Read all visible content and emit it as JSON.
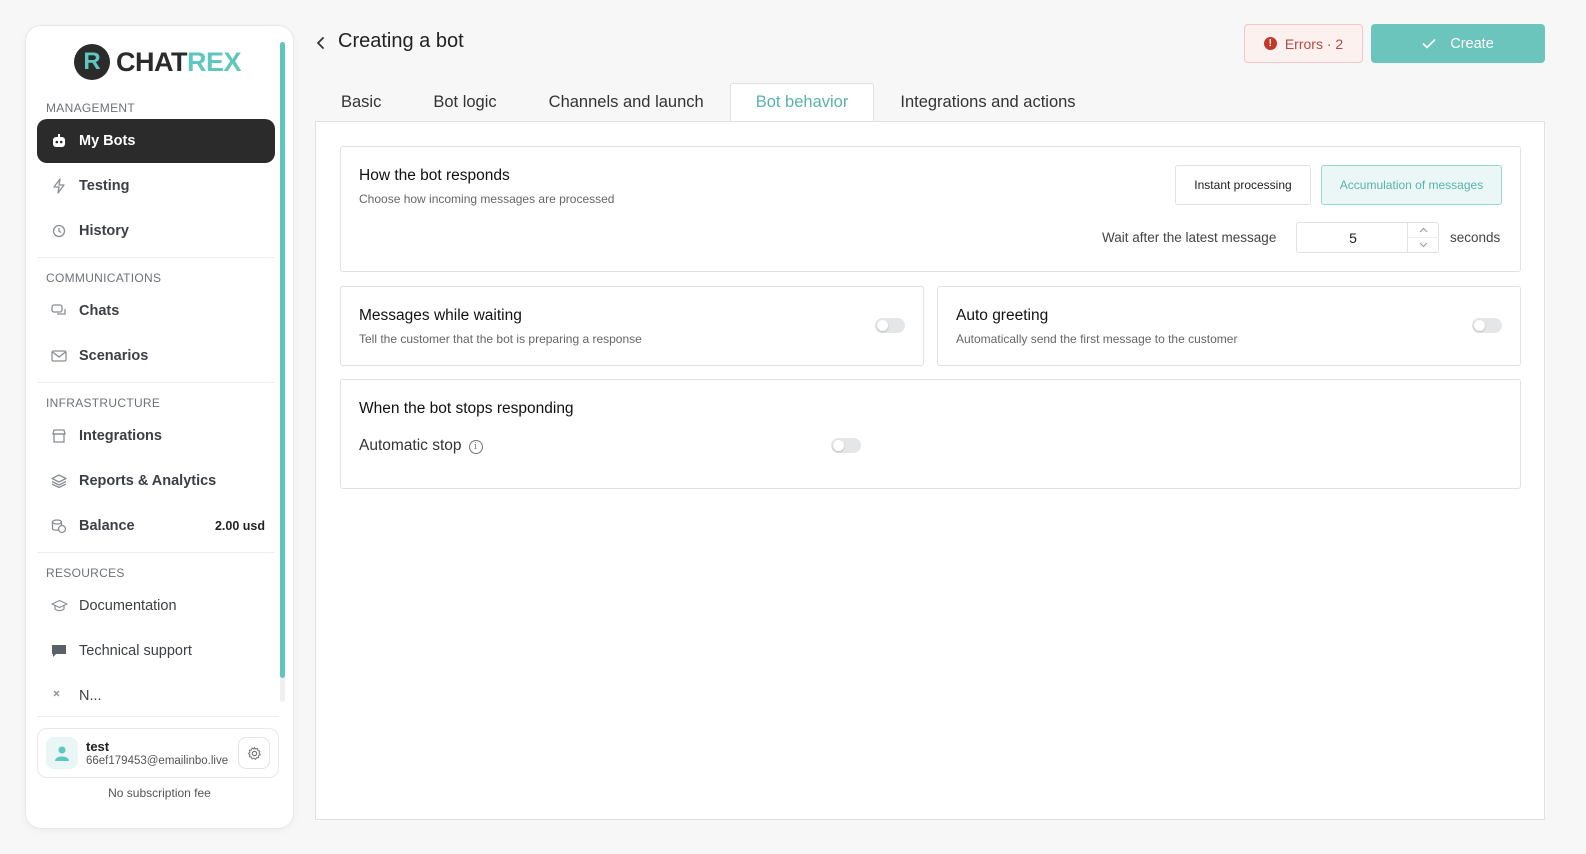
{
  "brand": {
    "mark": "R",
    "name_part1": "CHAT",
    "name_part2": "REX"
  },
  "sidebar": {
    "sections": [
      {
        "title": "MANAGEMENT"
      },
      {
        "title": "COMMUNICATIONS"
      },
      {
        "title": "INFRASTRUCTURE"
      },
      {
        "title": "RESOURCES"
      }
    ],
    "items": {
      "my_bots": "My Bots",
      "testing": "Testing",
      "history": "History",
      "chats": "Chats",
      "scenarios": "Scenarios",
      "integrations": "Integrations",
      "reports": "Reports & Analytics",
      "balance": "Balance",
      "balance_value": "2.00 usd",
      "documentation": "Documentation",
      "support": "Technical support",
      "news": "N..."
    },
    "user": {
      "name": "test",
      "email": "66ef179453@emailinbo.live"
    },
    "subscription": "No subscription fee"
  },
  "header": {
    "title": "Creating a bot",
    "errors_label": "Errors · 2",
    "create_label": "Create"
  },
  "tabs": [
    "Basic",
    "Bot logic",
    "Channels and launch",
    "Bot behavior",
    "Integrations and actions"
  ],
  "active_tab": "Bot behavior",
  "responds": {
    "title": "How the bot responds",
    "desc": "Choose how incoming messages are processed",
    "mode_instant": "Instant processing",
    "mode_accumulate": "Accumulation of messages",
    "selected_mode": "Accumulation of messages",
    "wait_label": "Wait after the latest message",
    "wait_value": "5",
    "wait_unit": "seconds"
  },
  "waiting": {
    "title": "Messages while waiting",
    "desc": "Tell the customer that the bot is preparing a response",
    "enabled": false
  },
  "greeting": {
    "title": "Auto greeting",
    "desc": "Automatically send the first message to the customer",
    "enabled": false
  },
  "stops": {
    "title": "When the bot stops responding",
    "auto_stop_label": "Automatic stop",
    "enabled": false
  },
  "colors": {
    "accent": "#5ec7be",
    "dark": "#2b2b2b",
    "error": "#b84a42"
  }
}
